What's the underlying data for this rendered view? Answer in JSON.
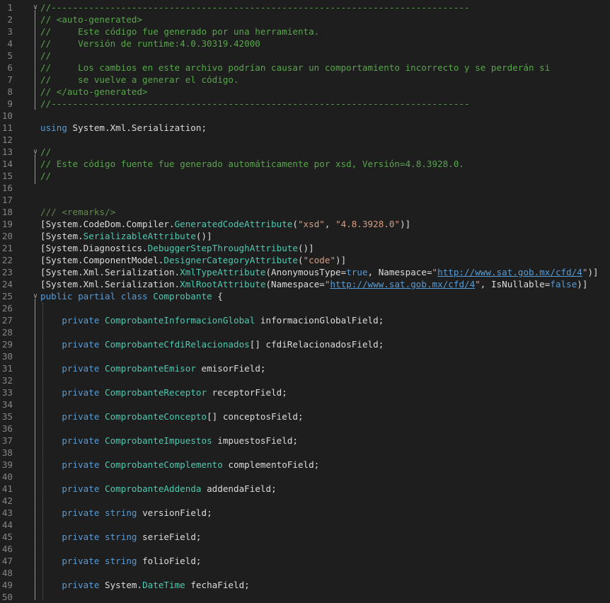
{
  "editor": {
    "lines": [
      {
        "n": "1",
        "tokens": [
          {
            "c": "c",
            "t": "//------------------------------------------------------------------------------"
          }
        ]
      },
      {
        "n": "2",
        "tokens": [
          {
            "c": "c",
            "t": "// <auto-generated>"
          }
        ]
      },
      {
        "n": "3",
        "tokens": [
          {
            "c": "c",
            "t": "//     Este código fue generado por una herramienta."
          }
        ]
      },
      {
        "n": "4",
        "tokens": [
          {
            "c": "c",
            "t": "//     Versión de runtime:4.0.30319.42000"
          }
        ]
      },
      {
        "n": "5",
        "tokens": [
          {
            "c": "c",
            "t": "//"
          }
        ]
      },
      {
        "n": "6",
        "tokens": [
          {
            "c": "c",
            "t": "//     Los cambios en este archivo podrían causar un comportamiento incorrecto y se perderán si"
          }
        ]
      },
      {
        "n": "7",
        "tokens": [
          {
            "c": "c",
            "t": "//     se vuelve a generar el código."
          }
        ]
      },
      {
        "n": "8",
        "tokens": [
          {
            "c": "c",
            "t": "// </auto-generated>"
          }
        ]
      },
      {
        "n": "9",
        "tokens": [
          {
            "c": "c",
            "t": "//------------------------------------------------------------------------------"
          }
        ]
      },
      {
        "n": "10",
        "tokens": []
      },
      {
        "n": "11",
        "tokens": [
          {
            "c": "k",
            "t": "using"
          },
          {
            "c": "p",
            "t": " System.Xml.Serialization;"
          }
        ]
      },
      {
        "n": "12",
        "tokens": []
      },
      {
        "n": "13",
        "tokens": [
          {
            "c": "c",
            "t": "//"
          }
        ]
      },
      {
        "n": "14",
        "tokens": [
          {
            "c": "c",
            "t": "// Este código fuente fue generado automáticamente por xsd, Versión=4.8.3928.0."
          }
        ]
      },
      {
        "n": "15",
        "tokens": [
          {
            "c": "c",
            "t": "//"
          }
        ]
      },
      {
        "n": "16",
        "tokens": []
      },
      {
        "n": "17",
        "tokens": []
      },
      {
        "n": "18",
        "tokens": [
          {
            "c": "x",
            "t": "/// <remarks/>"
          }
        ]
      },
      {
        "n": "19",
        "tokens": [
          {
            "c": "p",
            "t": "[System.CodeDom.Compiler."
          },
          {
            "c": "t",
            "t": "GeneratedCodeAttribute"
          },
          {
            "c": "p",
            "t": "("
          },
          {
            "c": "s",
            "t": "\"xsd\""
          },
          {
            "c": "p",
            "t": ", "
          },
          {
            "c": "s",
            "t": "\"4.8.3928.0\""
          },
          {
            "c": "p",
            "t": ")]"
          }
        ]
      },
      {
        "n": "20",
        "tokens": [
          {
            "c": "p",
            "t": "[System."
          },
          {
            "c": "t",
            "t": "SerializableAttribute"
          },
          {
            "c": "p",
            "t": "()]"
          }
        ]
      },
      {
        "n": "21",
        "tokens": [
          {
            "c": "p",
            "t": "[System.Diagnostics."
          },
          {
            "c": "t",
            "t": "DebuggerStepThroughAttribute"
          },
          {
            "c": "p",
            "t": "()]"
          }
        ]
      },
      {
        "n": "22",
        "tokens": [
          {
            "c": "p",
            "t": "[System.ComponentModel."
          },
          {
            "c": "t",
            "t": "DesignerCategoryAttribute"
          },
          {
            "c": "p",
            "t": "("
          },
          {
            "c": "s",
            "t": "\"code\""
          },
          {
            "c": "p",
            "t": ")]"
          }
        ]
      },
      {
        "n": "23",
        "tokens": [
          {
            "c": "p",
            "t": "[System.Xml.Serialization."
          },
          {
            "c": "t",
            "t": "XmlTypeAttribute"
          },
          {
            "c": "p",
            "t": "(AnonymousType="
          },
          {
            "c": "k",
            "t": "true"
          },
          {
            "c": "p",
            "t": ", Namespace="
          },
          {
            "c": "s",
            "t": "\""
          },
          {
            "c": "u",
            "t": "http://www.sat.gob.mx/cfd/4"
          },
          {
            "c": "s",
            "t": "\""
          },
          {
            "c": "p",
            "t": ")]"
          }
        ]
      },
      {
        "n": "24",
        "tokens": [
          {
            "c": "p",
            "t": "[System.Xml.Serialization."
          },
          {
            "c": "t",
            "t": "XmlRootAttribute"
          },
          {
            "c": "p",
            "t": "(Namespace="
          },
          {
            "c": "s",
            "t": "\""
          },
          {
            "c": "u",
            "t": "http://www.sat.gob.mx/cfd/4"
          },
          {
            "c": "s",
            "t": "\""
          },
          {
            "c": "p",
            "t": ", IsNullable="
          },
          {
            "c": "k",
            "t": "false"
          },
          {
            "c": "p",
            "t": ")]"
          }
        ]
      },
      {
        "n": "25",
        "tokens": [
          {
            "c": "k",
            "t": "public partial class "
          },
          {
            "c": "t",
            "t": "Comprobante"
          },
          {
            "c": "p",
            "t": " {"
          }
        ]
      },
      {
        "n": "26",
        "tokens": []
      },
      {
        "n": "27",
        "tokens": [
          {
            "c": "p",
            "t": "    "
          },
          {
            "c": "k",
            "t": "private "
          },
          {
            "c": "t",
            "t": "ComprobanteInformacionGlobal"
          },
          {
            "c": "p",
            "t": " informacionGlobalField;"
          }
        ]
      },
      {
        "n": "28",
        "tokens": []
      },
      {
        "n": "29",
        "tokens": [
          {
            "c": "p",
            "t": "    "
          },
          {
            "c": "k",
            "t": "private "
          },
          {
            "c": "t",
            "t": "ComprobanteCfdiRelacionados"
          },
          {
            "c": "p",
            "t": "[] cfdiRelacionadosField;"
          }
        ]
      },
      {
        "n": "30",
        "tokens": []
      },
      {
        "n": "31",
        "tokens": [
          {
            "c": "p",
            "t": "    "
          },
          {
            "c": "k",
            "t": "private "
          },
          {
            "c": "t",
            "t": "ComprobanteEmisor"
          },
          {
            "c": "p",
            "t": " emisorField;"
          }
        ]
      },
      {
        "n": "32",
        "tokens": []
      },
      {
        "n": "33",
        "tokens": [
          {
            "c": "p",
            "t": "    "
          },
          {
            "c": "k",
            "t": "private "
          },
          {
            "c": "t",
            "t": "ComprobanteReceptor"
          },
          {
            "c": "p",
            "t": " receptorField;"
          }
        ]
      },
      {
        "n": "34",
        "tokens": []
      },
      {
        "n": "35",
        "tokens": [
          {
            "c": "p",
            "t": "    "
          },
          {
            "c": "k",
            "t": "private "
          },
          {
            "c": "t",
            "t": "ComprobanteConcepto"
          },
          {
            "c": "p",
            "t": "[] conceptosField;"
          }
        ]
      },
      {
        "n": "36",
        "tokens": []
      },
      {
        "n": "37",
        "tokens": [
          {
            "c": "p",
            "t": "    "
          },
          {
            "c": "k",
            "t": "private "
          },
          {
            "c": "t",
            "t": "ComprobanteImpuestos"
          },
          {
            "c": "p",
            "t": " impuestosField;"
          }
        ]
      },
      {
        "n": "38",
        "tokens": []
      },
      {
        "n": "39",
        "tokens": [
          {
            "c": "p",
            "t": "    "
          },
          {
            "c": "k",
            "t": "private "
          },
          {
            "c": "t",
            "t": "ComprobanteComplemento"
          },
          {
            "c": "p",
            "t": " complementoField;"
          }
        ]
      },
      {
        "n": "40",
        "tokens": []
      },
      {
        "n": "41",
        "tokens": [
          {
            "c": "p",
            "t": "    "
          },
          {
            "c": "k",
            "t": "private "
          },
          {
            "c": "t",
            "t": "ComprobanteAddenda"
          },
          {
            "c": "p",
            "t": " addendaField;"
          }
        ]
      },
      {
        "n": "42",
        "tokens": []
      },
      {
        "n": "43",
        "tokens": [
          {
            "c": "p",
            "t": "    "
          },
          {
            "c": "k",
            "t": "private string"
          },
          {
            "c": "p",
            "t": " versionField;"
          }
        ]
      },
      {
        "n": "44",
        "tokens": []
      },
      {
        "n": "45",
        "tokens": [
          {
            "c": "p",
            "t": "    "
          },
          {
            "c": "k",
            "t": "private string"
          },
          {
            "c": "p",
            "t": " serieField;"
          }
        ]
      },
      {
        "n": "46",
        "tokens": []
      },
      {
        "n": "47",
        "tokens": [
          {
            "c": "p",
            "t": "    "
          },
          {
            "c": "k",
            "t": "private string"
          },
          {
            "c": "p",
            "t": " folioField;"
          }
        ]
      },
      {
        "n": "48",
        "tokens": []
      },
      {
        "n": "49",
        "tokens": [
          {
            "c": "p",
            "t": "    "
          },
          {
            "c": "k",
            "t": "private "
          },
          {
            "c": "p",
            "t": "System."
          },
          {
            "c": "t",
            "t": "DateTime"
          },
          {
            "c": "p",
            "t": " fechaField;"
          }
        ]
      },
      {
        "n": "50",
        "tokens": []
      }
    ],
    "collapse_marker_lines": [
      "1",
      "13",
      "25"
    ]
  }
}
